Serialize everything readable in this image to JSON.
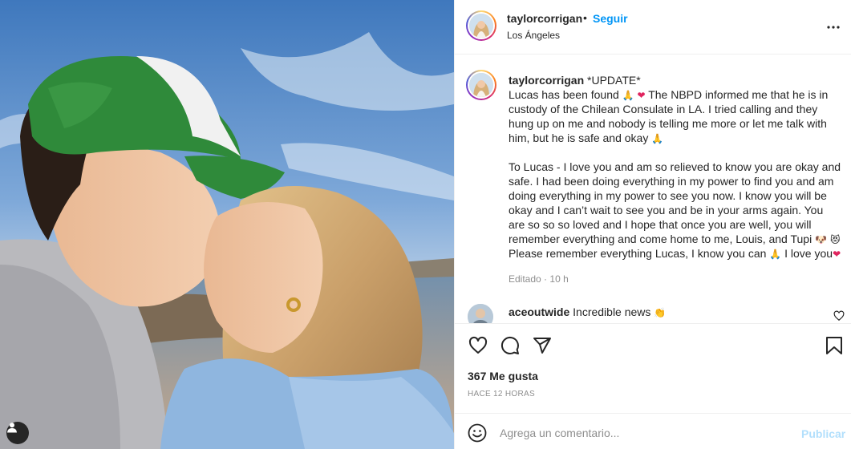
{
  "post": {
    "username": "taylorcorrigan",
    "separator": "•",
    "follow_label": "Seguir",
    "location": "Los Ángeles",
    "more_icon": "more-horizontal-icon",
    "user_tag_icon": "user-icon"
  },
  "caption": {
    "username": "taylorcorrigan",
    "title": "*UPDATE*",
    "p1_a": "Lucas has been found",
    "p1_b": "The NBPD informed me that he is in custody of the Chilean Consulate in LA. I tried calling and they hung up on me and nobody is telling me more or let me talk with him, but he is safe and okay",
    "p2_a": "To Lucas - I love you and am so relieved to know you are okay and safe. I had been doing everything in my power to find you and am doing everything in my power to see you now. I know you will be okay and I can’t wait to see you and be in your arms again. You are so so so loved and I hope that once you are well, you will remember everything and come home to me, Louis, and Tupi",
    "p2_b": "Please remember everything Lucas, I know you can",
    "p2_c": "I love you",
    "emoji_pray": "🙏",
    "emoji_heart": "❤",
    "emoji_dog": "🐶",
    "emoji_cat": "😻",
    "edited": "Editado",
    "dot": "·",
    "age": "10 h"
  },
  "comment": {
    "username": "aceoutwide",
    "text": "Incredible news",
    "emoji": "👏"
  },
  "actions": {
    "like_icon": "heart-icon",
    "comment_icon": "comment-icon",
    "share_icon": "share-icon",
    "save_icon": "bookmark-icon",
    "likes": "367 Me gusta",
    "time": "HACE 12 HORAS"
  },
  "comment_box": {
    "emoji_icon": "smiley-icon",
    "placeholder": "Agrega un comentario...",
    "publish_label": "Publicar"
  }
}
